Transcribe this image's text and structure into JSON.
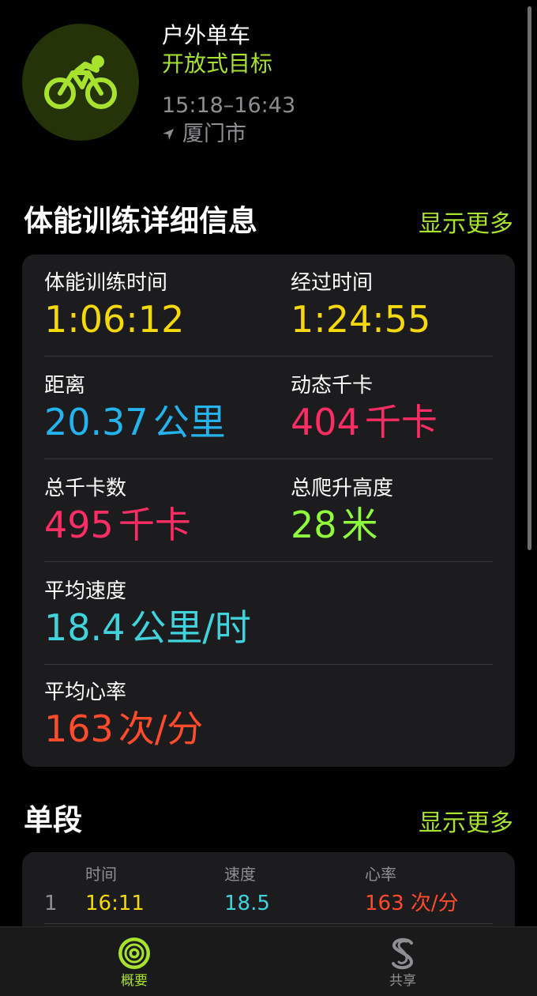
{
  "header": {
    "icon": "cycling-icon",
    "title": "户外单车",
    "goal": "开放式目标",
    "time_range": "15:18–16:43",
    "location": "厦门市"
  },
  "details": {
    "section_title": "体能训练详细信息",
    "show_more": "显示更多",
    "workout_time": {
      "label": "体能训练时间",
      "value": "1:06:12"
    },
    "elapsed_time": {
      "label": "经过时间",
      "value": "1:24:55"
    },
    "distance": {
      "label": "距离",
      "value": "20.37",
      "unit": "公里"
    },
    "active_calories": {
      "label": "动态千卡",
      "value": "404",
      "unit": "千卡"
    },
    "total_calories": {
      "label": "总千卡数",
      "value": "495",
      "unit": "千卡"
    },
    "elevation_gain": {
      "label": "总爬升高度",
      "value": "28",
      "unit": "米"
    },
    "avg_speed": {
      "label": "平均速度",
      "value": "18.4",
      "unit": "公里/时"
    },
    "avg_heart_rate": {
      "label": "平均心率",
      "value": "163",
      "unit": "次/分"
    }
  },
  "splits": {
    "section_title": "单段",
    "show_more": "显示更多",
    "headers": {
      "time": "时间",
      "speed": "速度",
      "heart_rate": "心率"
    },
    "rows": [
      {
        "index": "1",
        "time": "16:11",
        "speed": "18.5",
        "heart_rate": "163",
        "heart_rate_unit": "次/分"
      }
    ]
  },
  "tabbar": {
    "tabs": [
      {
        "label": "概要",
        "icon": "activity-rings-icon",
        "selected": true
      },
      {
        "label": "共享",
        "icon": "sharing-icon",
        "selected": false
      }
    ]
  },
  "colors": {
    "accent_green": "#a6e22e",
    "yellow": "#f5d90a",
    "blue": "#23b4f0",
    "pink": "#fb2d64",
    "green": "#8ffb3d",
    "teal": "#40d3dd",
    "red": "#ff4a2c"
  }
}
